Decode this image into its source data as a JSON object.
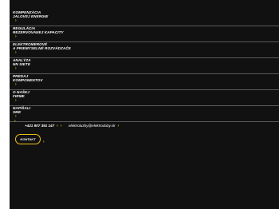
{
  "menu": {
    "items": [
      {
        "line1": "KOMPENZÁCIA",
        "line2": "JALOVEJ ENERGIE"
      },
      {
        "line1": "REGULÁCIA",
        "line2": "REZERVOVANEJ KAPACITY"
      },
      {
        "line1": "ELEKTROMEROVÉ",
        "line2": "A PRIEMYSELNÉ ROZVÁDZAČE"
      },
      {
        "line1": "ANALÝZA",
        "line2": "NN SIETE"
      },
      {
        "line1": "PREDAJ",
        "line2": "KOMPONENTOV"
      },
      {
        "line1": "O NAŠEJ",
        "line2": "FIRME"
      },
      {
        "line1": "NAPÍŠALI",
        "line2": "SME"
      }
    ],
    "arrow_glyph": "›"
  },
  "contact": {
    "phone": "+421 907 391 147",
    "email": "elektroluzby@elektroduby.sk",
    "button_label": "KONTAKT"
  },
  "colors": {
    "background": "#111111",
    "accent": "#f2c21a",
    "divider": "#5a5a5a",
    "text": "#ffffff"
  }
}
